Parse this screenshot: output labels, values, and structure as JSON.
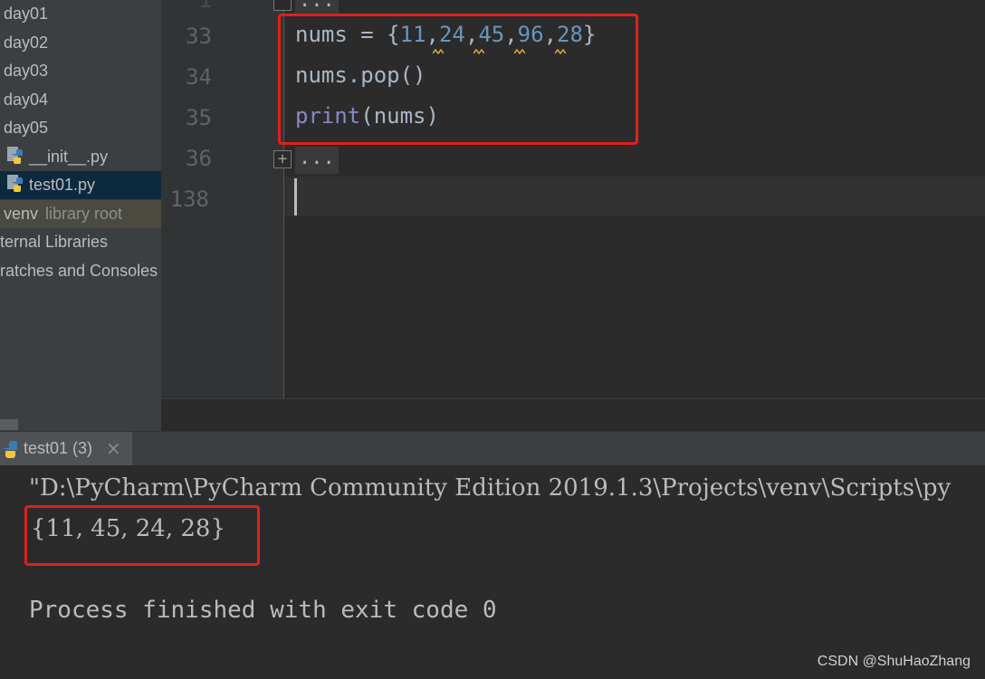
{
  "sidebar": {
    "items": [
      {
        "label": "day01"
      },
      {
        "label": "day02"
      },
      {
        "label": "day03"
      },
      {
        "label": "day04"
      },
      {
        "label": "day05"
      },
      {
        "label": "__init__.py"
      },
      {
        "label": "test01.py"
      },
      {
        "label": "venv",
        "suffix": "library root"
      },
      {
        "label": "ternal Libraries"
      },
      {
        "label": "ratches and Consoles"
      }
    ]
  },
  "editor": {
    "top_fold_dots": "...",
    "lines": [
      {
        "no": "33",
        "text": "nums = {11,24,45,96,28}"
      },
      {
        "no": "34",
        "text": "nums.pop()"
      },
      {
        "no": "35",
        "text": "print(nums)"
      },
      {
        "no": "36",
        "text": "..."
      },
      {
        "no": "138",
        "text": ""
      }
    ],
    "tokens": {
      "nums": "nums",
      "eq": " = {",
      "n1": "11",
      "n2": "24",
      "n3": "45",
      "n4": "96",
      "n5": "28",
      "comma": ",",
      "close": "}",
      "pop_call": "nums.pop()",
      "print_kw": "print",
      "print_args": "(nums)"
    },
    "fold_plus": "+"
  },
  "run": {
    "tab_title": "test01 (3)",
    "close_glyph": "×",
    "command": "\"D:\\PyCharm\\PyCharm Community Edition 2019.1.3\\Projects\\venv\\Scripts\\py",
    "output": "{11, 45, 24, 28}",
    "exit_message": "Process finished with exit code 0"
  },
  "watermark": "CSDN @ShuHaoZhang",
  "colors": {
    "highlight_box": "#e0201c",
    "number": "#6897bb",
    "builtin": "#8888c6"
  }
}
